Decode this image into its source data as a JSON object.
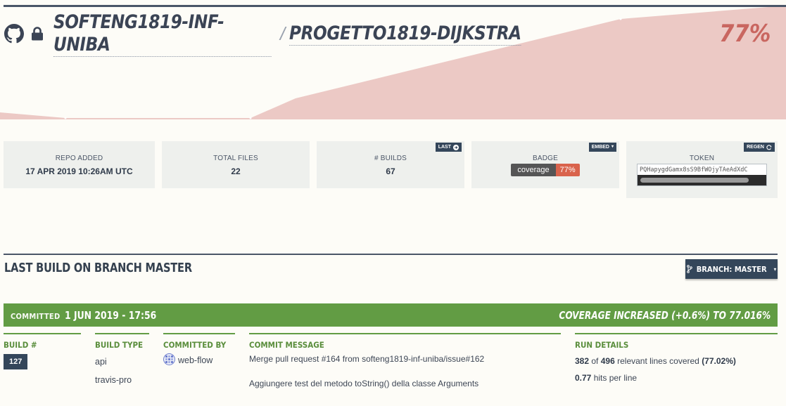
{
  "header": {
    "owner": "SOFTENG1819-INF-UNIBA",
    "separator": "/",
    "repo": "PROGETTO1819-DIJKSTRA",
    "coverage_percent": "77%"
  },
  "colors": {
    "accent_green": "#629c44",
    "navy": "#34465a",
    "coverage_red": "#c96660",
    "chart_fill": "#e8c2bd"
  },
  "stats": {
    "repo_added": {
      "label": "REPO ADDED",
      "value": "17 APR 2019 10:26AM UTC"
    },
    "total_files": {
      "label": "TOTAL FILES",
      "value": "22"
    },
    "builds": {
      "label": "# BUILDS",
      "value": "67",
      "button": "LAST"
    },
    "badge": {
      "label": "BADGE",
      "button": "EMBED",
      "badge_left": "coverage",
      "badge_right": "77%"
    },
    "token": {
      "label": "TOKEN",
      "button": "REGEN",
      "value": "PQHapygdGamx8sS9BfWOjyTAeAdXdC"
    }
  },
  "last_build": {
    "title": "LAST BUILD ON BRANCH MASTER",
    "branch_button": "BRANCH: MASTER",
    "committed_label": "COMMITTED",
    "committed_date": "1 JUN 2019 - 17:56",
    "coverage_change": "COVERAGE INCREASED (+0.6%) TO 77.016%",
    "columns": {
      "build_num_head": "BUILD #",
      "build_num": "127",
      "build_type_head": "BUILD TYPE",
      "build_type": [
        "api",
        "travis-pro"
      ],
      "committed_by_head": "COMMITTED BY",
      "committed_by": "web-flow",
      "commit_message_head": "COMMIT MESSAGE",
      "commit_message": [
        "Merge pull request #164 from softeng1819-inf-uniba/issue#162",
        "Aggiungere test del metodo toString() della classe Arguments"
      ],
      "run_details_head": "RUN DETAILS",
      "covered_lines": "382",
      "of_text": "of",
      "relevant_lines": "496",
      "relevant_text": "relevant lines covered",
      "covered_pct": "(77.02%)",
      "hits_value": "0.77",
      "hits_text": "hits per line"
    }
  }
}
